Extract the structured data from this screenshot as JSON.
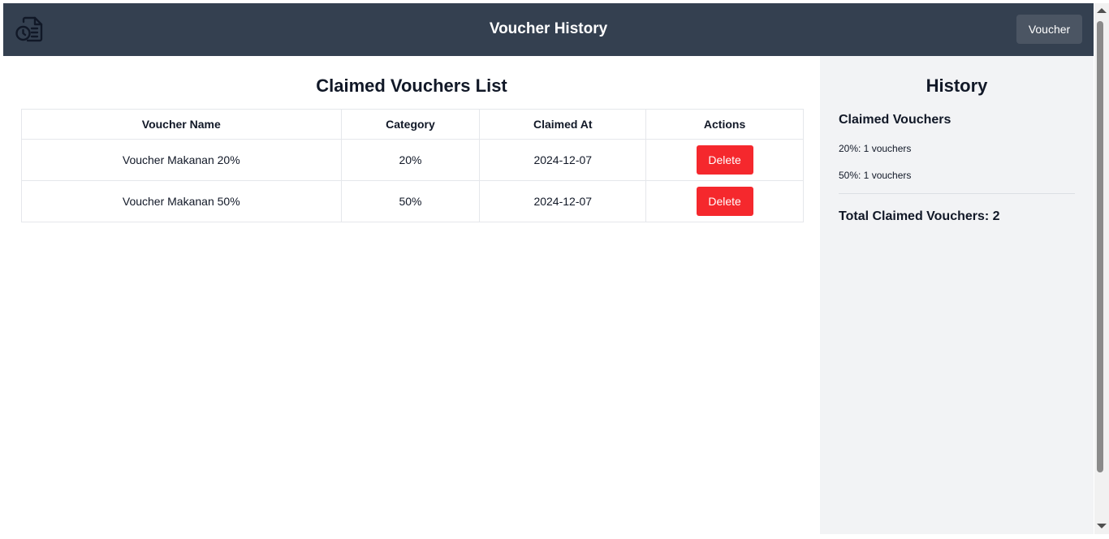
{
  "header": {
    "title": "Voucher History",
    "voucher_button": "Voucher",
    "logo_icon": "document-clock-icon"
  },
  "main": {
    "heading": "Claimed Vouchers List",
    "columns": [
      "Voucher Name",
      "Category",
      "Claimed At",
      "Actions"
    ],
    "rows": [
      {
        "name": "Voucher Makanan 20%",
        "category": "20%",
        "claimed_at": "2024-12-07",
        "action": "Delete"
      },
      {
        "name": "Voucher Makanan 50%",
        "category": "50%",
        "claimed_at": "2024-12-07",
        "action": "Delete"
      }
    ]
  },
  "sidebar": {
    "heading": "History",
    "subheading": "Claimed Vouchers",
    "stats": [
      "20%: 1 vouchers",
      "50%: 1 vouchers"
    ],
    "total": "Total Claimed Vouchers: 2"
  },
  "colors": {
    "header_bg": "#344050",
    "header_button_bg": "#4b5563",
    "delete_button_bg": "#f5282d",
    "sidebar_bg": "#f2f3f5"
  }
}
